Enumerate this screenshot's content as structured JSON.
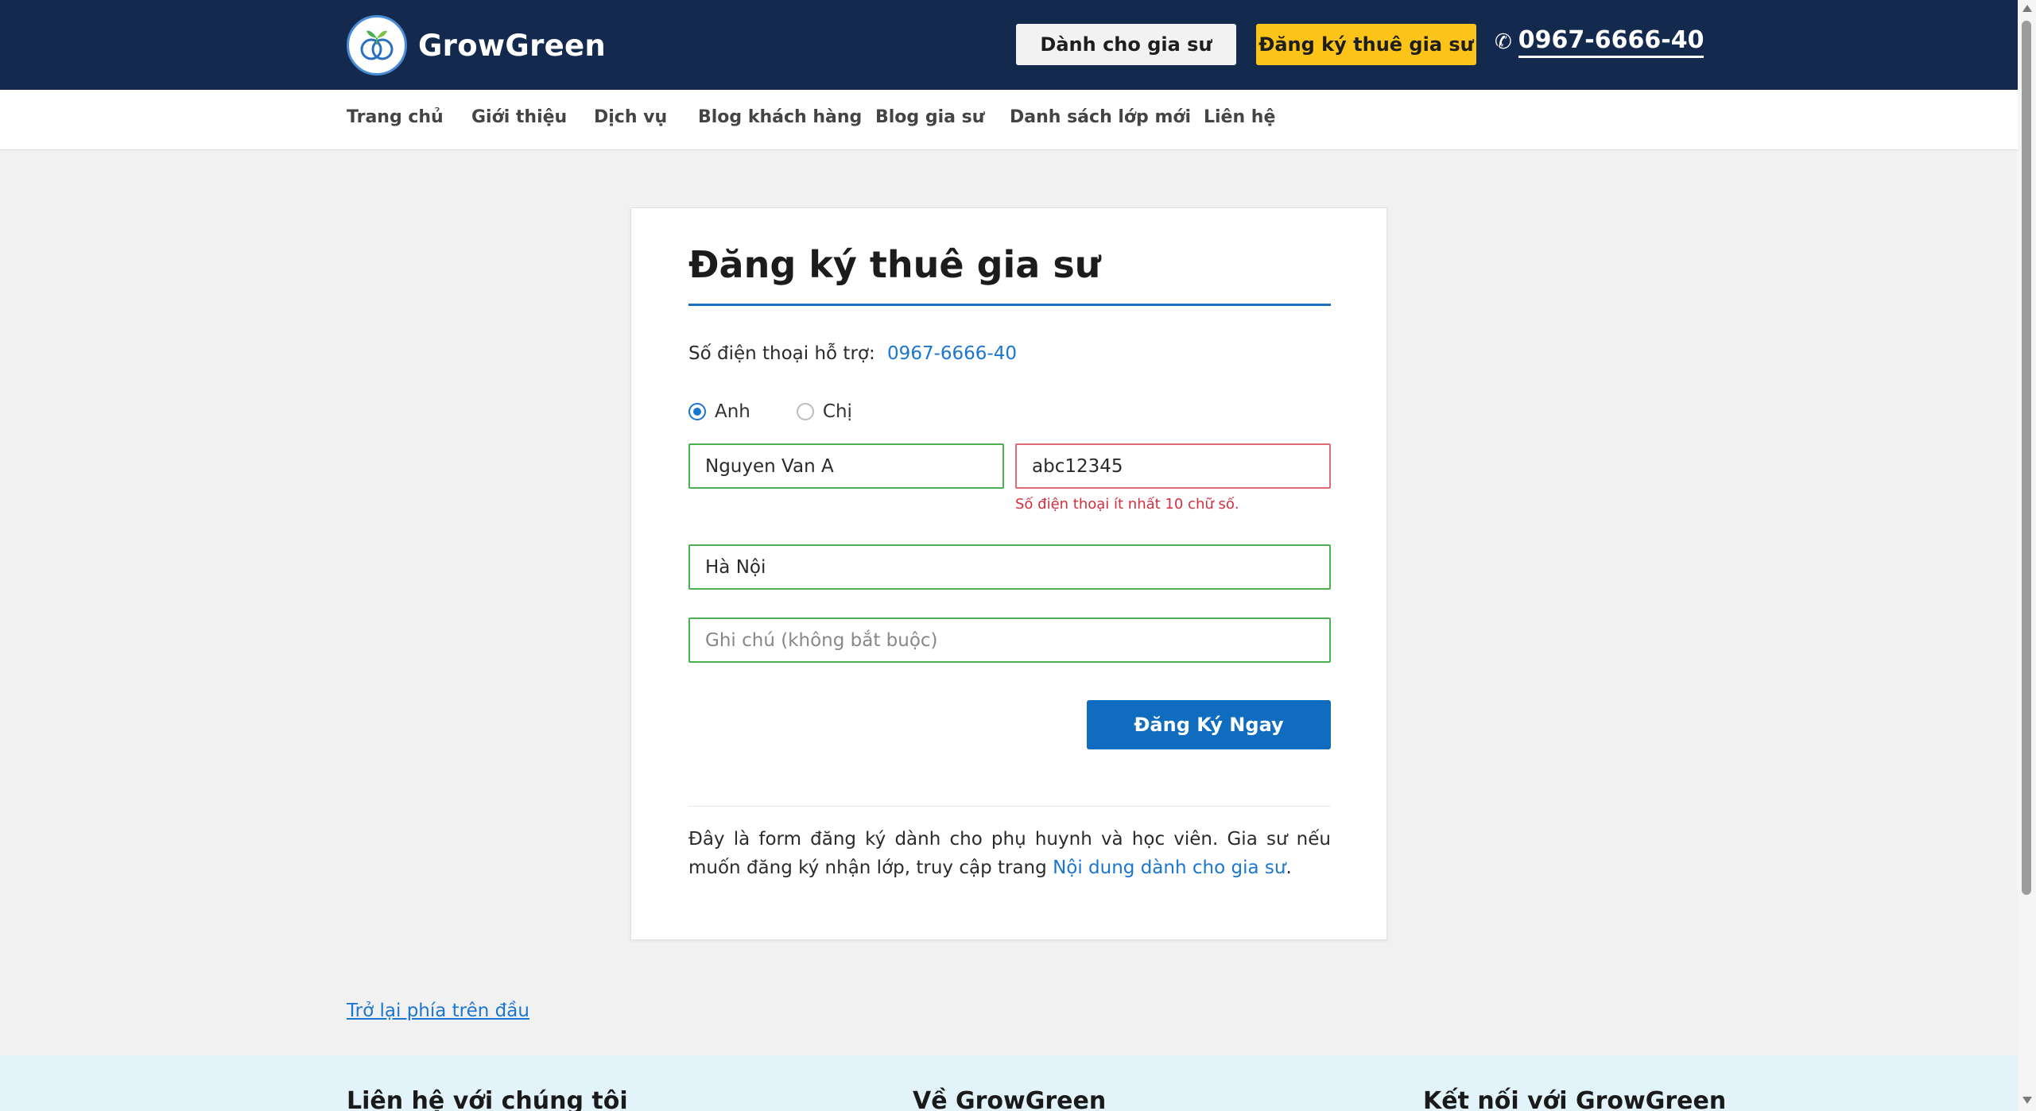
{
  "header": {
    "brand": "GrowGreen",
    "btn_tutor": "Dành cho gia sư",
    "btn_hire": "Đăng ký thuê gia sư",
    "phone": "0967-6666-40"
  },
  "nav": {
    "items": [
      "Trang chủ",
      "Giới thiệu",
      "Dịch vụ",
      "Blog khách hàng",
      "Blog gia sư",
      "Danh sách lớp mới",
      "Liên hệ"
    ]
  },
  "form": {
    "title": "Đăng ký thuê gia sư",
    "support_label": "Số điện thoại hỗ trợ:",
    "support_phone": "0967-6666-40",
    "radio_options": [
      "Anh",
      "Chị"
    ],
    "selected_gender": "Anh",
    "name_value": "Nguyen Van A",
    "phone_value": "abc12345",
    "phone_error": "Số điện thoại ít nhất 10 chữ số.",
    "city_value": "Hà Nội",
    "note_placeholder": "Ghi chú (không bắt buộc)",
    "submit_label": "Đăng Ký Ngay",
    "info_text": "Đây là form đăng ký dành cho phụ huynh và học viên. Gia sư nếu muốn đăng ký nhận lớp, truy cập trang",
    "info_link": "Nội dung dành cho gia sư",
    "info_end": "."
  },
  "back_to_top": "Trở lại phía trên đầu",
  "footer": {
    "col1": "Liên hệ với chúng tôi",
    "col2": "Về GrowGreen",
    "col3": "Kết nối với GrowGreen"
  },
  "colors": {
    "header_bg": "#132a4e",
    "accent_yellow": "#fcc419",
    "primary_blue": "#0f6cbf",
    "error_red": "#d3303f",
    "valid_green": "#4caf50",
    "footer_bg": "#e2f3fa"
  },
  "icons": {
    "phone": "phone-icon",
    "logo": "growgreen-logo-icon"
  }
}
